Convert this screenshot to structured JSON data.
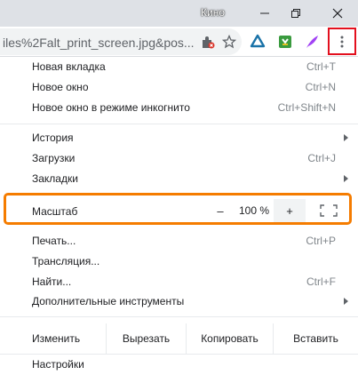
{
  "window": {
    "title": "Кино"
  },
  "toolbar": {
    "url": "iles%2Falt_print_screen.jpg&pos..."
  },
  "menu": {
    "group1": [
      {
        "label": "Новая вкладка",
        "accel": "Ctrl+T"
      },
      {
        "label": "Новое окно",
        "accel": "Ctrl+N"
      },
      {
        "label": "Новое окно в режиме инкогнито",
        "accel": "Ctrl+Shift+N"
      }
    ],
    "group2": [
      {
        "label": "История",
        "accel": ""
      },
      {
        "label": "Загрузки",
        "accel": "Ctrl+J"
      },
      {
        "label": "Закладки",
        "accel": ""
      }
    ],
    "zoom": {
      "label": "Масштаб",
      "minus": "–",
      "value": "100 %",
      "plus": "+"
    },
    "group3": [
      {
        "label": "Печать...",
        "accel": "Ctrl+P"
      },
      {
        "label": "Трансляция...",
        "accel": ""
      },
      {
        "label": "Найти...",
        "accel": "Ctrl+F"
      },
      {
        "label": "Дополнительные инструменты",
        "accel": ""
      }
    ],
    "edit": {
      "label": "Изменить",
      "cut": "Вырезать",
      "copy": "Копировать",
      "paste": "Вставить"
    },
    "settings": {
      "label": "Настройки"
    }
  },
  "colors": {
    "highlight": "#f57c00",
    "menu_button_border": "#e3101e"
  }
}
